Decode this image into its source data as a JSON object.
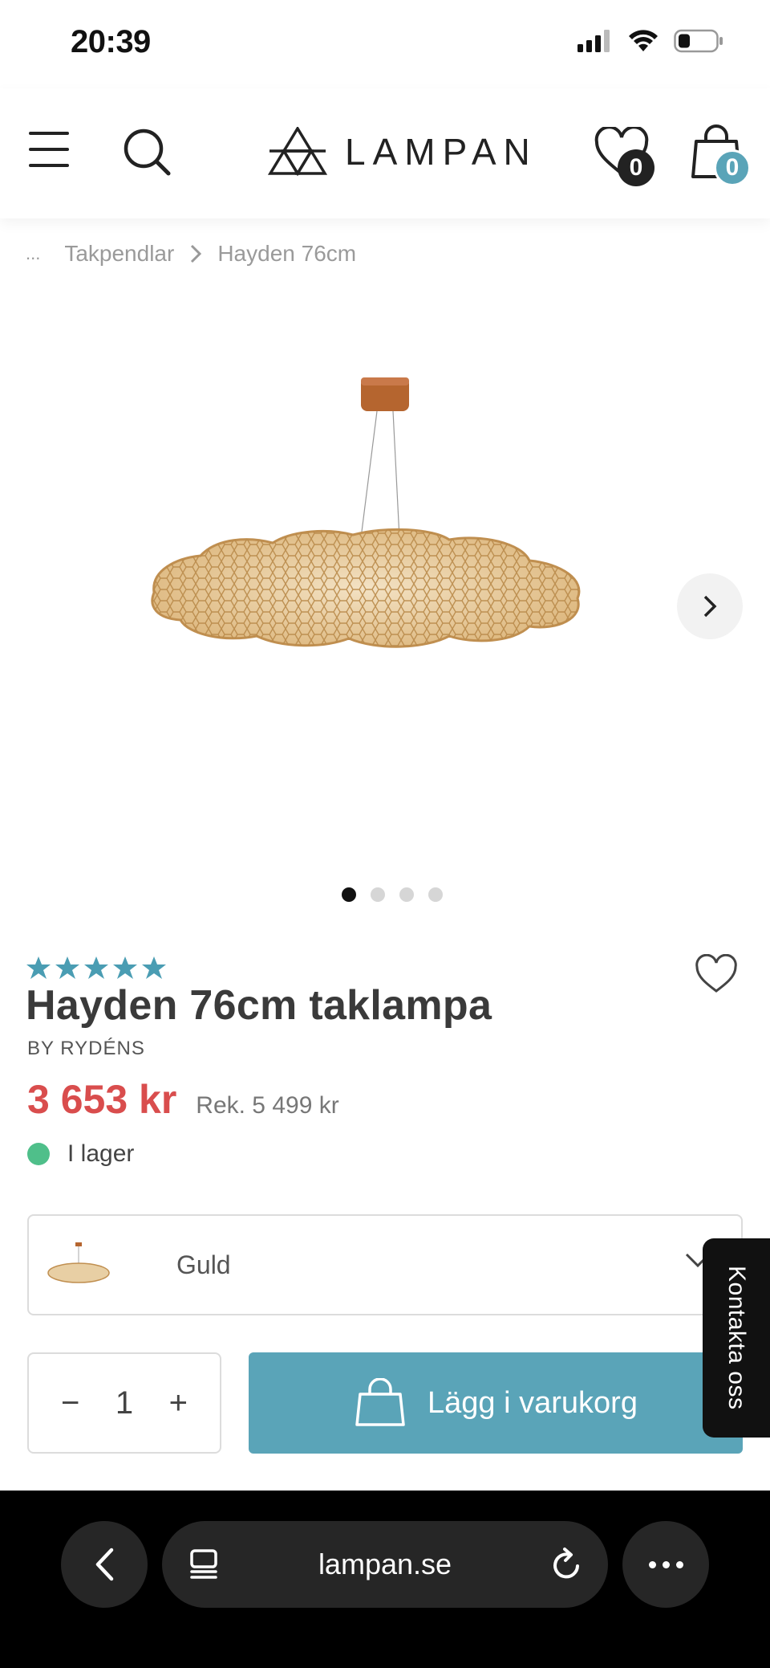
{
  "status": {
    "time": "20:39"
  },
  "header": {
    "logo_text": "LAMPAN",
    "wishlist_count": "0",
    "cart_count": "0"
  },
  "breadcrumb": {
    "ellipsis": "...",
    "items": [
      "Takpendlar",
      "Hayden 76cm"
    ]
  },
  "gallery": {
    "total_images": 4,
    "active_index": 0
  },
  "product": {
    "rating_stars": 5,
    "title": "Hayden 76cm taklampa",
    "brand": "BY RYDÉNS",
    "price": "3 653 kr",
    "rek_price": "Rek. 5 499 kr",
    "stock": "I lager"
  },
  "variant": {
    "selected": "Guld"
  },
  "quantity": {
    "value": "1",
    "minus": "−",
    "plus": "+"
  },
  "add_to_cart": {
    "label": "Lägg i varukorg"
  },
  "contact": {
    "label": "Kontakta oss"
  },
  "browser": {
    "url": "lampan.se"
  },
  "colors": {
    "accent": "#5aa4b8",
    "price_red": "#d94d4d",
    "stock_green": "#4fbf8a"
  }
}
